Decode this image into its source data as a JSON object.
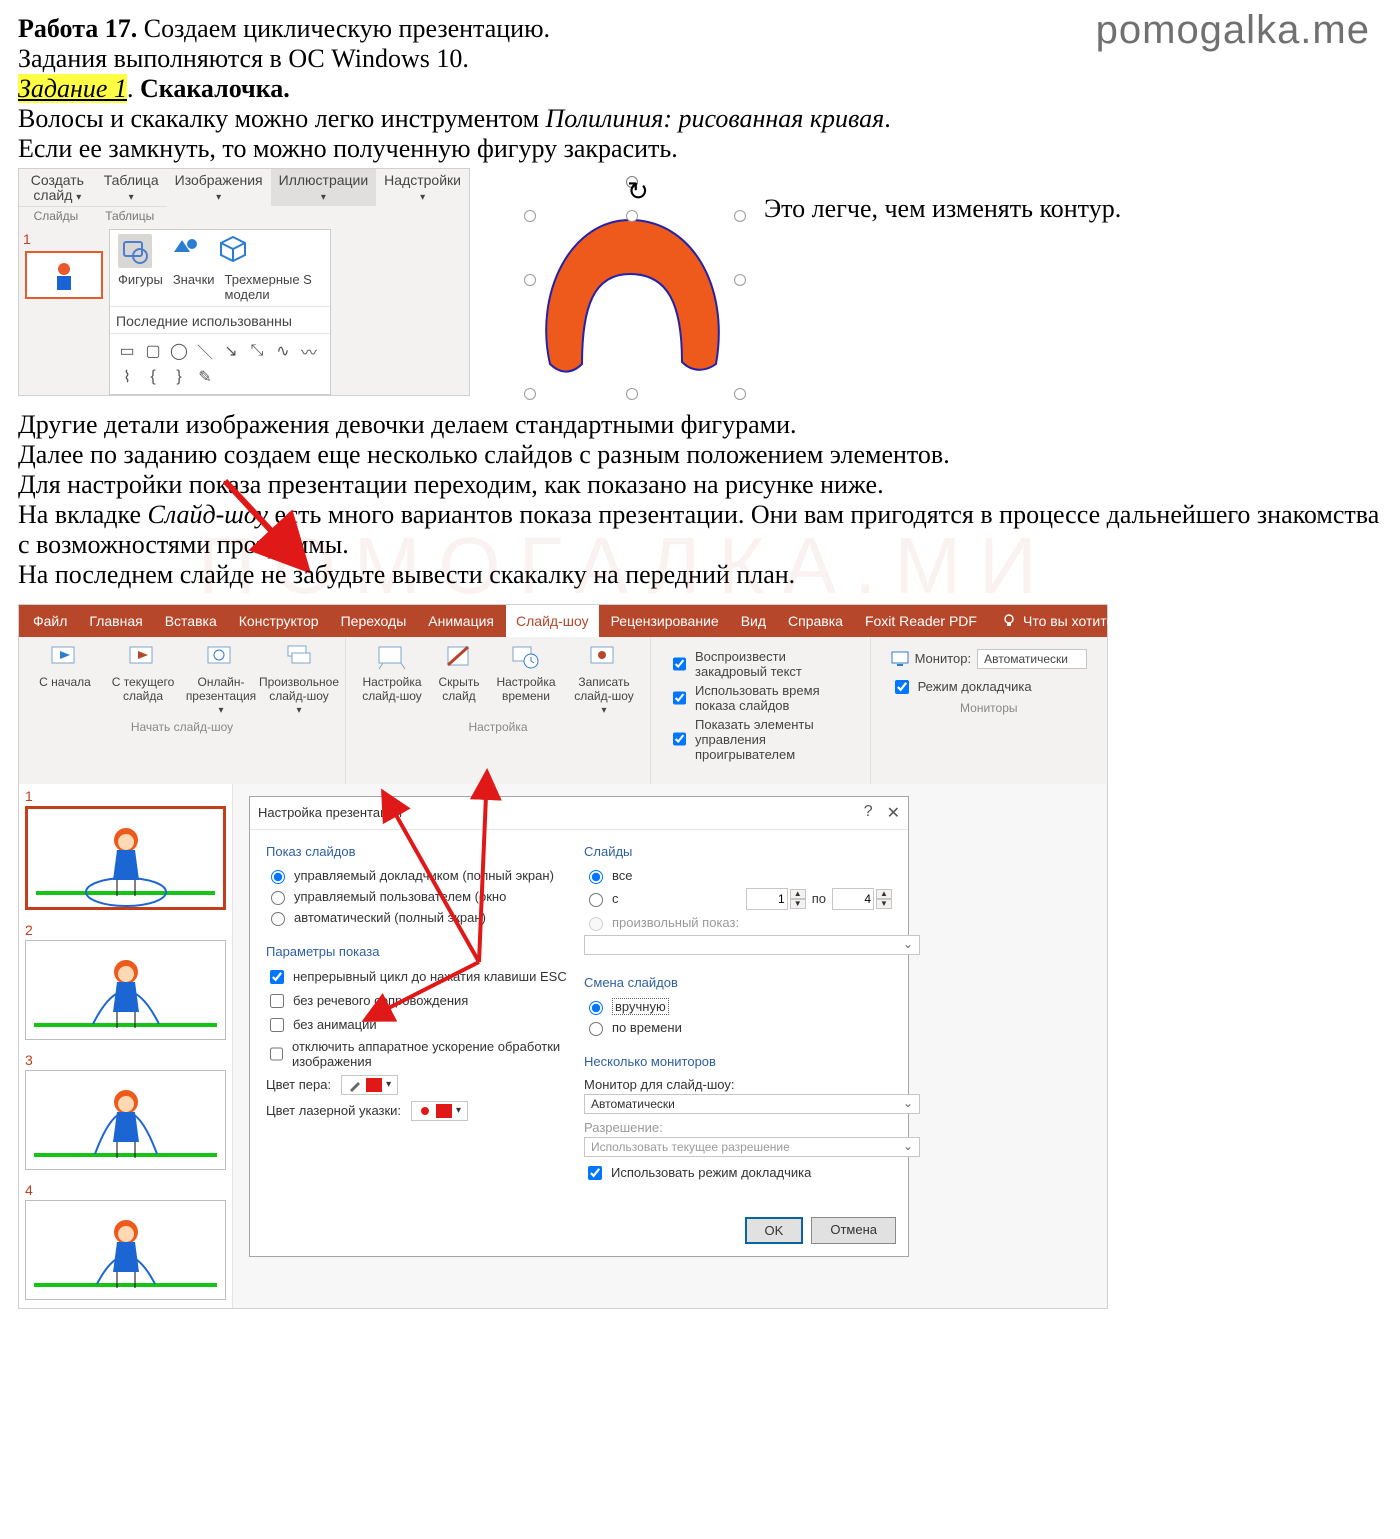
{
  "header": {
    "watermark": "pomogalka.me",
    "work_label": "Работа 17.",
    "work_title": " Создаем циклическую презентацию.",
    "os_line": "Задания выполняются в ОС Windows 10.",
    "task_badge": "Задание 1",
    "task_name": "Скакалочка.",
    "line1a": "Волосы и скакалку можно легко инструментом ",
    "line1b": "Полилиния: рисованная кривая",
    "line1c": ".",
    "line2": "Если ее замкнуть, то можно полученную фигуру закрасить."
  },
  "scr1": {
    "ribbon": {
      "new_slide": "Создать слайд",
      "table": "Таблица",
      "images": "Изображения",
      "illustr": "Иллюстрации",
      "addins": "Надстройки",
      "slides_grp": "Слайды",
      "tables_grp": "Таблицы",
      "shapes": "Фигуры",
      "icons": "Значки",
      "models": "Трехмерные S модели",
      "recent": "Последние использованны"
    },
    "side_note": "Это легче, чем изменять контур."
  },
  "mid_text": {
    "p1": "Другие детали изображения девочки делаем стандартными фигурами.",
    "p2": "Далее по заданию создаем еще несколько слайдов с разным положением элементов.",
    "p3": "Для настройки показа презентации переходим, как показано на рисунке ниже.",
    "p4a": "На вкладке ",
    "p4b": "Слайд-шоу",
    "p4c": " есть много вариантов показа презентации. Они вам пригодятся в процессе дальнейшего знакомства с возможностями программы.",
    "p5": "На последнем слайде не забудьте вывести скакалку на передний план."
  },
  "tabs": {
    "file": "Файл",
    "home": "Главная",
    "insert": "Вставка",
    "design": "Конструктор",
    "trans": "Переходы",
    "anim": "Анимация",
    "show": "Слайд-шоу",
    "review": "Рецензирование",
    "view": "Вид",
    "help": "Справка",
    "foxit": "Foxit Reader PDF",
    "tell": "Что вы хотите сделать?"
  },
  "ribbon_show": {
    "from_start": "С начала",
    "from_cur": "С текущего слайда",
    "online": "Онлайн-презентация",
    "custom": "Произвольное слайд-шоу",
    "setup": "Настройка слайд-шоу",
    "hide": "Скрыть слайд",
    "timing": "Настройка времени",
    "record": "Записать слайд-шоу",
    "chk_narr": "Воспроизвести закадровый текст",
    "chk_time": "Использовать время показа слайдов",
    "chk_ctrl": "Показать элементы управления проигрывателем",
    "grp_start": "Начать слайд-шоу",
    "grp_setup": "Настройка",
    "grp_mon": "Мониторы",
    "mon_label": "Монитор:",
    "mon_val": "Автоматически",
    "presenter": "Режим докладчика"
  },
  "dlg": {
    "title": "Настройка презентации",
    "fs_show": "Показ слайдов",
    "r_speaker": "управляемый докладчиком (полный экран)",
    "r_user": "управляемый пользователем (окно",
    "r_auto": "автоматический (полный экран)",
    "fs_opts": "Параметры показа",
    "c_loop": "непрерывный цикл до нажатия клавиши ESC",
    "c_nonarr": "без речевого сопровождения",
    "c_noanim": "без анимации",
    "c_hw": "отключить аппаратное ускорение обработки изображения",
    "pen": "Цвет пера:",
    "laser": "Цвет лазерной указки:",
    "fs_slides": "Слайды",
    "r_all": "все",
    "r_from": "с",
    "to": "по",
    "r_custom": "произвольный показ:",
    "fs_adv": "Смена слайдов",
    "r_manual": "вручную",
    "r_timing": "по времени",
    "fs_mon": "Несколько мониторов",
    "mon_for": "Монитор для слайд-шоу:",
    "mon_auto": "Автоматически",
    "res_label": "Разрешение:",
    "res_val": "Использовать текущее разрешение",
    "use_pres": "Использовать режим докладчика",
    "from_val": "1",
    "to_val": "4",
    "ok": "OK",
    "cancel": "Отмена"
  },
  "wm2": "ПОМОГАЛКА.МИ"
}
